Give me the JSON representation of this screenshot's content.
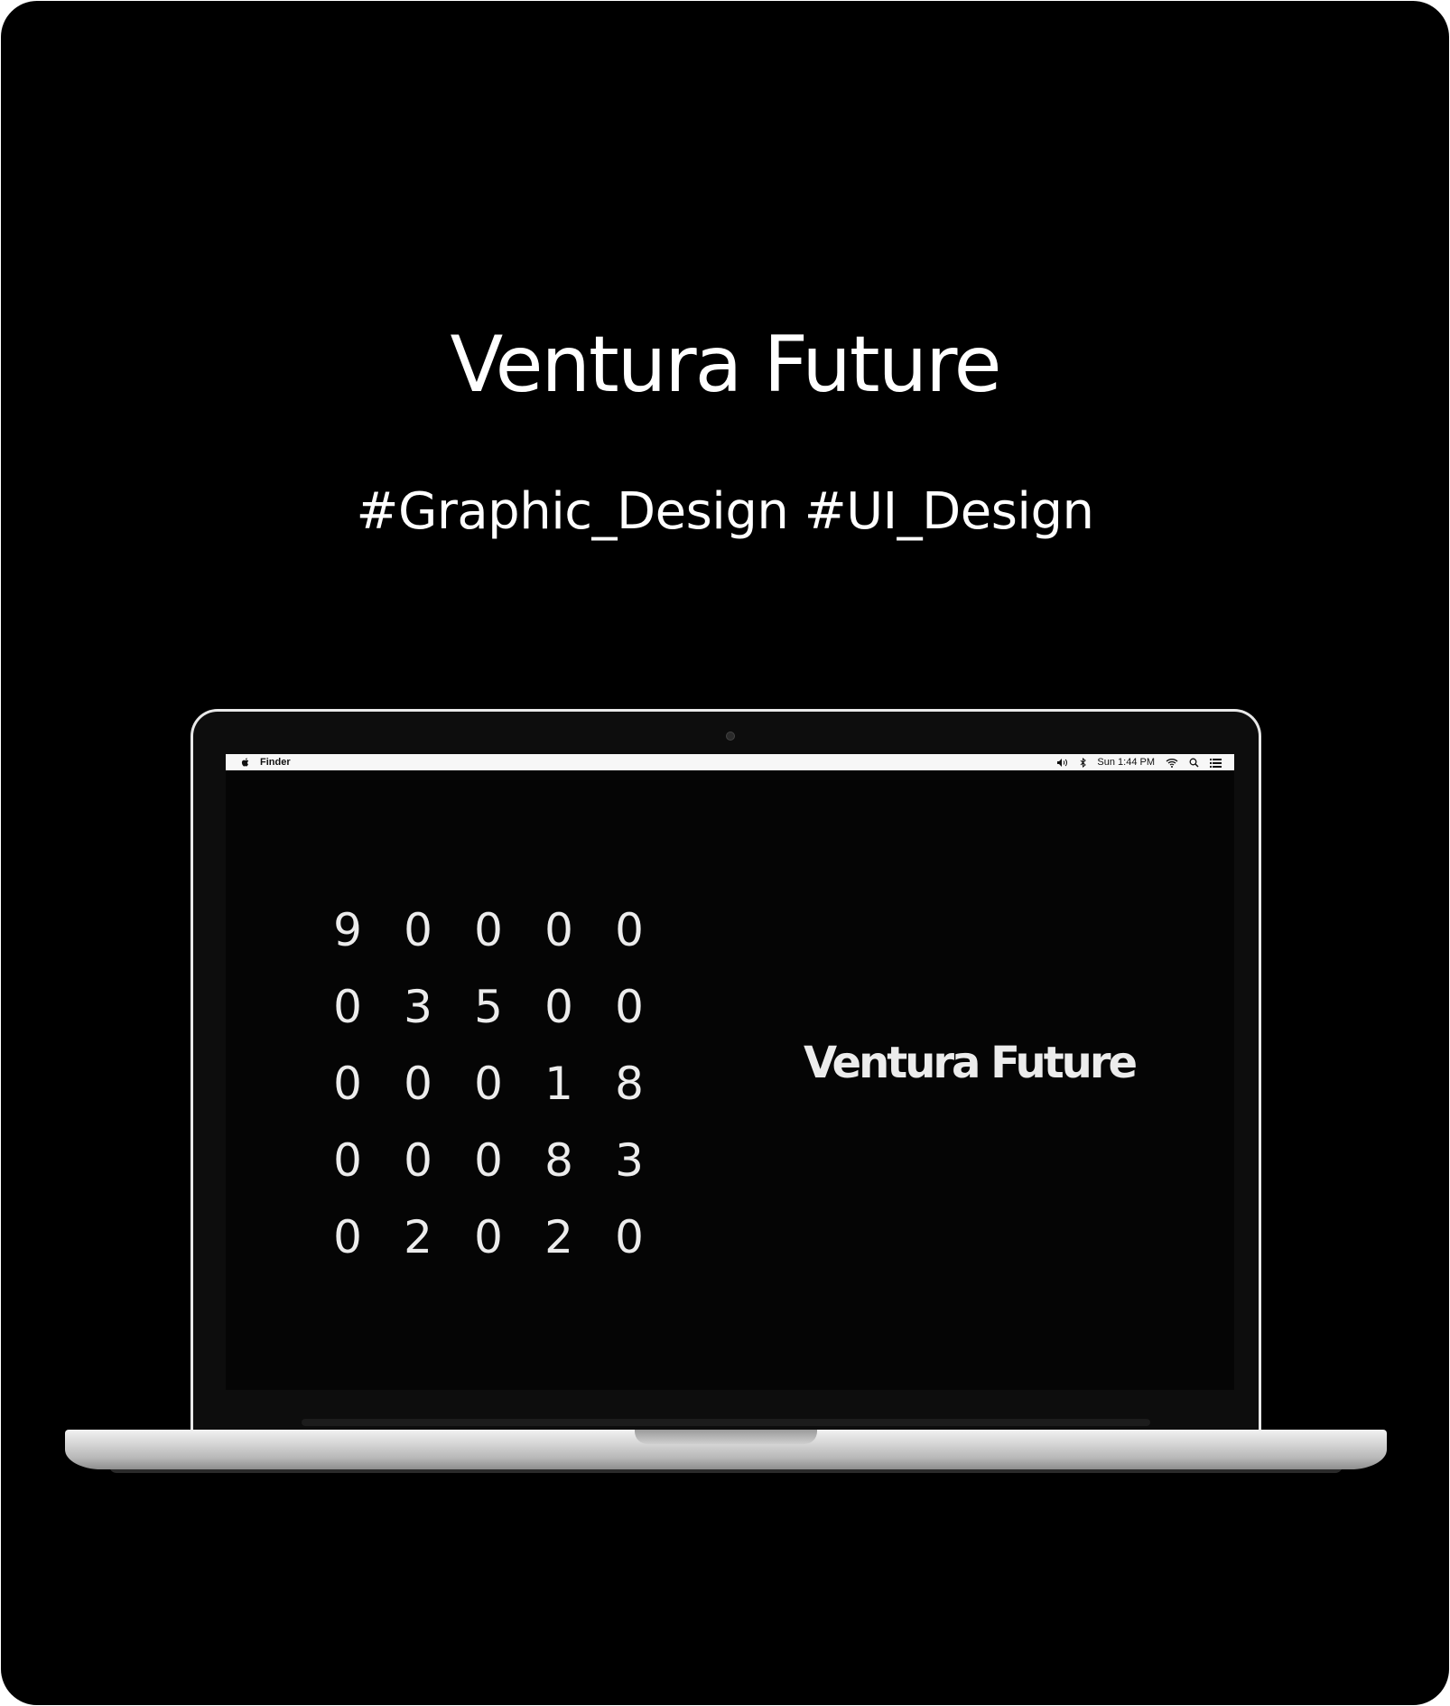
{
  "hero": {
    "title": "Ventura Future",
    "tags": "#Graphic_Design #UI_Design"
  },
  "menubar": {
    "app_name": "Finder",
    "clock": "Sun 1:44 PM",
    "icons": [
      "apple-icon",
      "volume-icon",
      "bluetooth-icon",
      "wifi-icon",
      "search-icon",
      "list-icon"
    ]
  },
  "screen": {
    "digits": [
      [
        "9",
        "0",
        "0",
        "0",
        "0"
      ],
      [
        "0",
        "3",
        "5",
        "0",
        "0"
      ],
      [
        "0",
        "0",
        "0",
        "1",
        "8"
      ],
      [
        "0",
        "0",
        "0",
        "8",
        "3"
      ],
      [
        "0",
        "2",
        "0",
        "2",
        "0"
      ]
    ],
    "title": "Ventura Future"
  },
  "colors": {
    "background": "#000000",
    "text": "#ffffff",
    "screen_text": "#ececec",
    "menubar": "#f7f7f7"
  }
}
